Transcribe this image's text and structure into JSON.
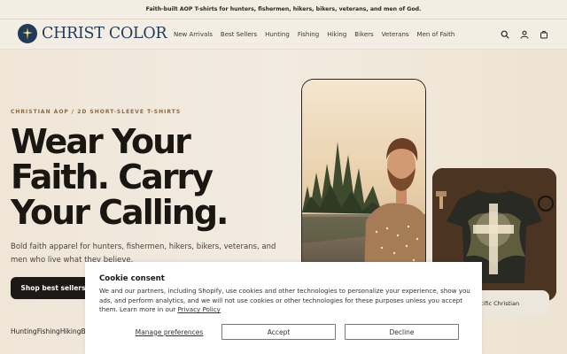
{
  "announcement": "Faith-built AOP T-shirts for hunters, fishermen, hikers, bikers, veterans, and men of God.",
  "brand": {
    "name": "CHRIST COLOR",
    "accent": "#1f3b57"
  },
  "nav": [
    "New Arrivals",
    "Best Sellers",
    "Hunting",
    "Fishing",
    "Hiking",
    "Bikers",
    "Veterans",
    "Men of Faith"
  ],
  "header_icons": [
    "search-icon",
    "account-icon",
    "cart-icon"
  ],
  "hero": {
    "eyebrow": "CHRISTIAN AOP / 2D SHORT-SLEEVE T-SHIRTS",
    "headline_lines": [
      "Wear Your",
      "Faith. Carry",
      "Your Calling."
    ],
    "subcopy": "Bold faith apparel for hunters, fishermen, hikers, bikers, veterans, and men who live what they believe.",
    "cta": "Shop best sellers",
    "categories": [
      "Hunting",
      "Fishing",
      "Hiking",
      "Bi"
    ],
    "side_card_label": "acific Christian"
  },
  "cookie": {
    "title": "Cookie consent",
    "body": "We and our partners, including Shopify, use cookies and other technologies to personalize your experience, show you ads, and perform analytics, and we will not use cookies or other technologies for these purposes unless you accept them. Learn more in our",
    "policy_link": "Privacy Policy",
    "manage": "Manage preferences",
    "accept": "Accept",
    "decline": "Decline"
  }
}
